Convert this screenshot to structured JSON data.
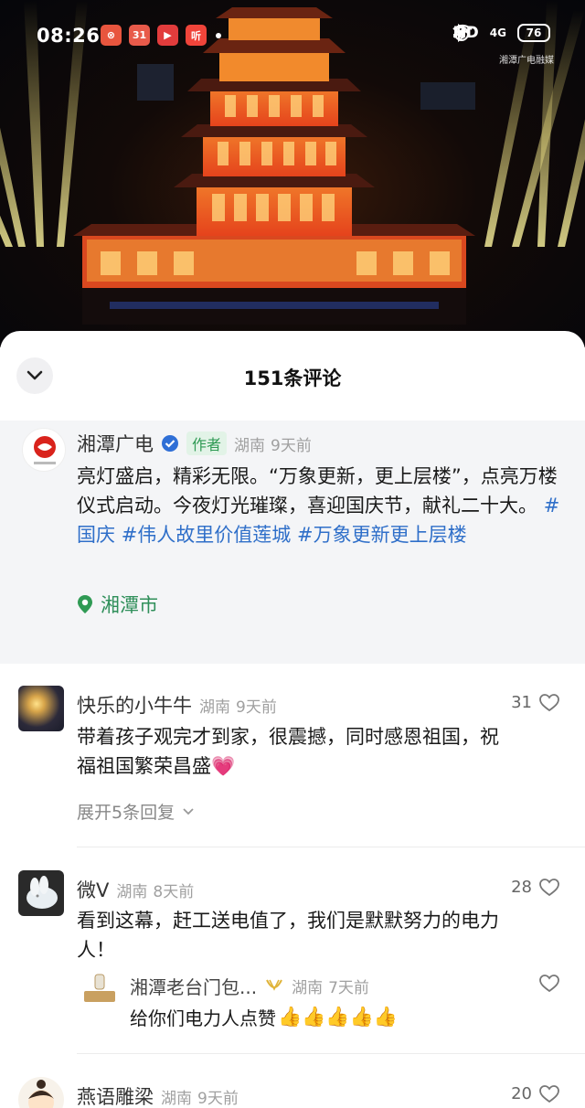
{
  "status_bar": {
    "time": "08:26",
    "app_icons": [
      {
        "name": "qq-icon",
        "color": "#e8553e",
        "glyph": "⊗"
      },
      {
        "name": "app-31-icon",
        "color": "#e85a4a",
        "glyph": "31"
      },
      {
        "name": "video-app-icon",
        "color": "#e23c3c",
        "glyph": "▶"
      },
      {
        "name": "listen-app-icon",
        "color": "#f0443a",
        "glyph": "听"
      }
    ],
    "network": "HD",
    "signal": "4G",
    "battery": "76",
    "watermark": "湘潭广电融媒"
  },
  "sheet": {
    "title": "151条评论"
  },
  "author_comment": {
    "name": "湘潭广电",
    "tag": "作者",
    "region": "湖南",
    "time": "9天前",
    "text": "亮灯盛启，精彩无限。“万象更新，更上层楼”，点亮万楼仪式启动。今夜灯光璀璨，喜迎国庆节，献礼二十大。",
    "hashtags": [
      "#国庆",
      "#伟人故里价值莲城",
      "#万象更新更上层楼"
    ],
    "location": "湘潭市",
    "avatar_caption": "湘潭广电"
  },
  "comments": [
    {
      "name": "快乐的小牛牛",
      "region": "湖南",
      "time": "9天前",
      "likes": "31",
      "line1": "带着孩子观完才到家，很震撼，同时感恩祖国，祝",
      "line2": "福祖国繁荣昌盛",
      "emoji": "💗",
      "expand": "展开5条回复"
    },
    {
      "name": "微V",
      "region": "湖南",
      "time": "8天前",
      "likes": "28",
      "line1": "看到这幕，赶工送电值了，我们是默默努力的电力",
      "line2": "人！",
      "reply": {
        "name": "湘潭老台门包...",
        "region": "湖南",
        "time": "7天前",
        "text": "给你们电力人点赞",
        "emoji": "👍👍👍👍👍",
        "avatar_caption": "老台门"
      }
    },
    {
      "name": "燕语雕梁",
      "region": "湖南",
      "time": "9天前",
      "likes": "20"
    }
  ]
}
